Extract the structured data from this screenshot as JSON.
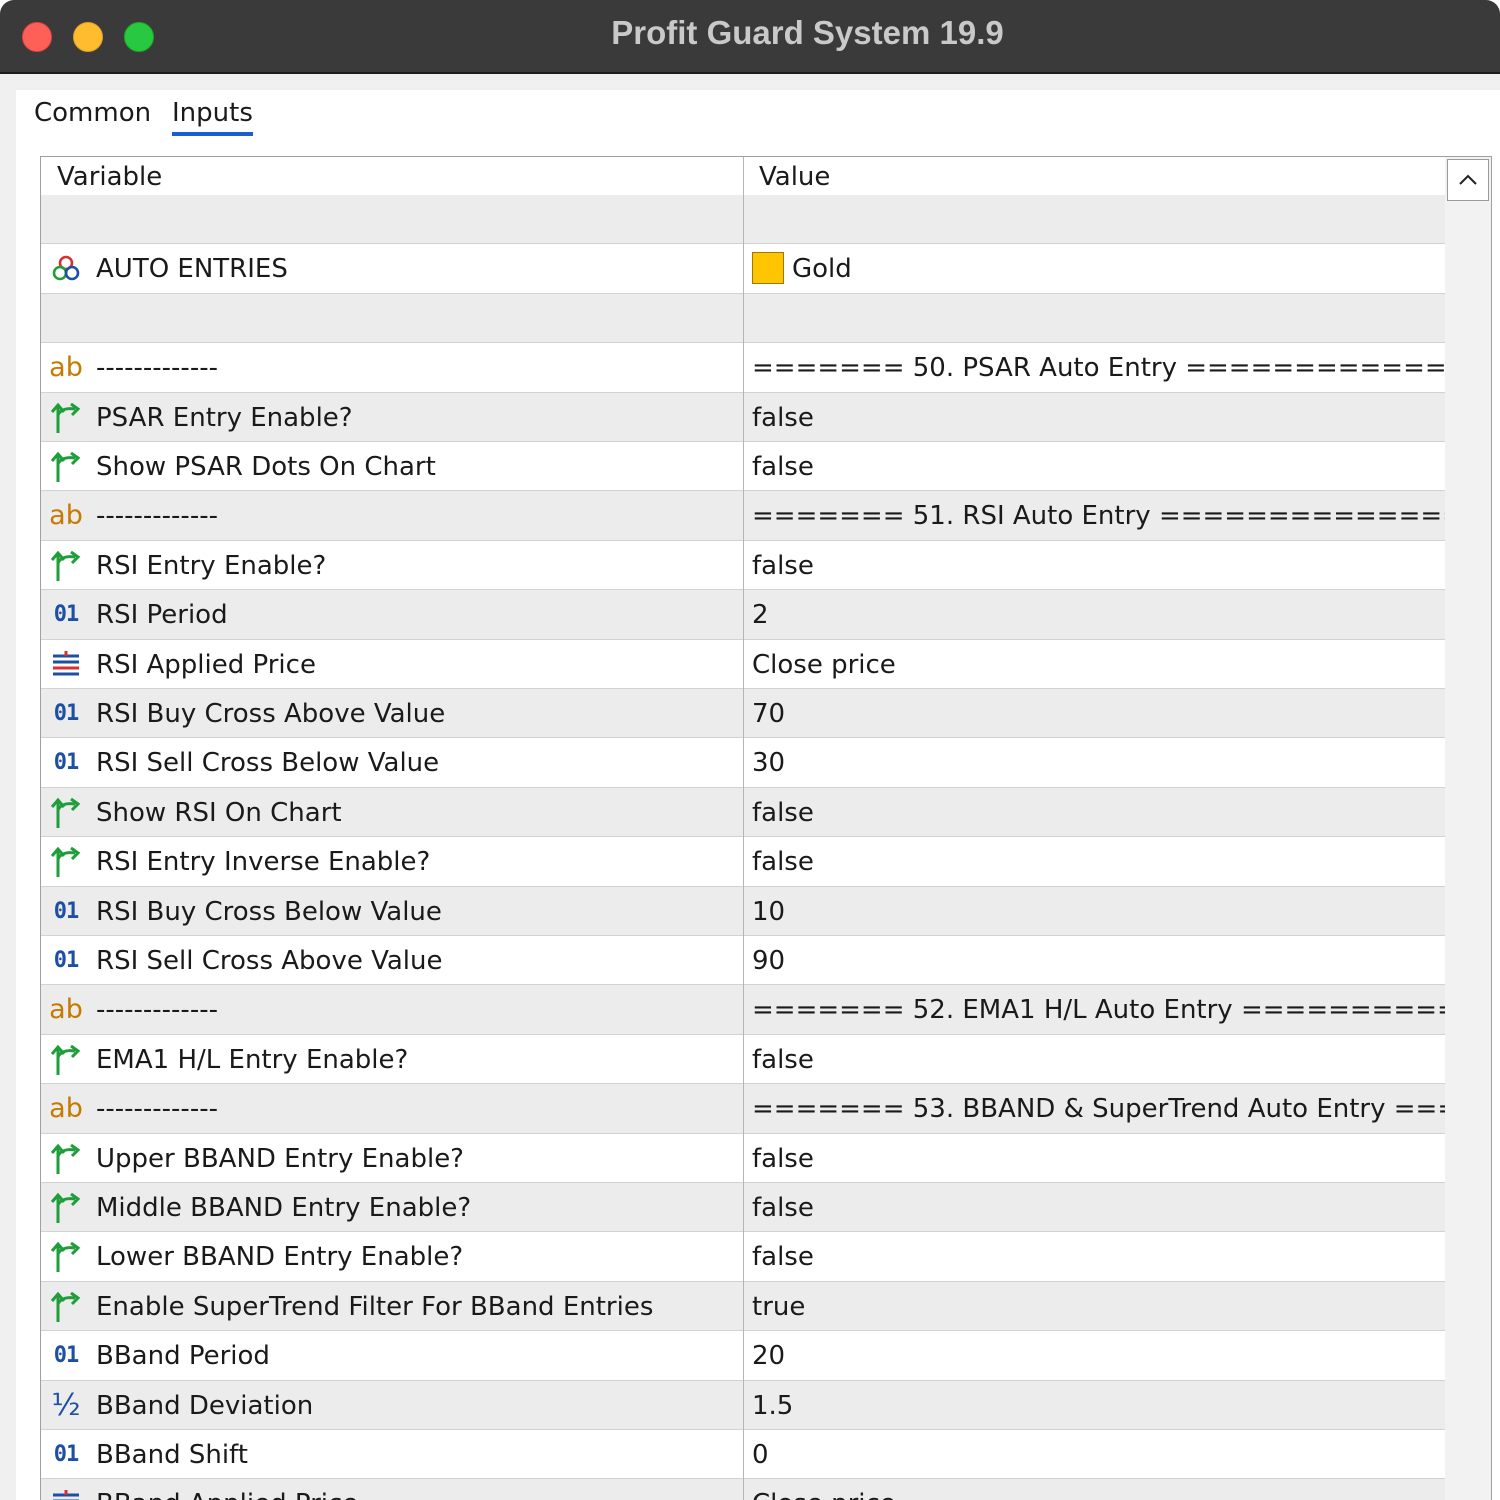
{
  "window": {
    "title": "Profit Guard System 19.9"
  },
  "tabs": [
    {
      "label": "Common"
    },
    {
      "label": "Inputs"
    }
  ],
  "table": {
    "headers": {
      "variable": "Variable",
      "value": "Value"
    },
    "rows": [
      {
        "icon": "",
        "variable": "",
        "value": ""
      },
      {
        "icon": "color-palette-icon",
        "variable": "AUTO ENTRIES",
        "value": "Gold",
        "swatch": "#ffc500"
      },
      {
        "icon": "",
        "variable": "",
        "value": ""
      },
      {
        "icon": "string-icon",
        "variable": "-------------",
        "value": "======= 50. PSAR Auto Entry =============..."
      },
      {
        "icon": "boolean-icon",
        "variable": "PSAR Entry Enable?",
        "value": "false"
      },
      {
        "icon": "boolean-icon",
        "variable": "Show PSAR Dots On Chart",
        "value": "false"
      },
      {
        "icon": "string-icon",
        "variable": "-------------",
        "value": "======= 51. RSI Auto Entry ==============..."
      },
      {
        "icon": "boolean-icon",
        "variable": "RSI Entry Enable?",
        "value": "false"
      },
      {
        "icon": "integer-icon",
        "variable": "RSI Period",
        "value": "2"
      },
      {
        "icon": "enum-icon",
        "variable": "RSI Applied Price",
        "value": "Close price"
      },
      {
        "icon": "integer-icon",
        "variable": "RSI Buy Cross Above Value",
        "value": "70"
      },
      {
        "icon": "integer-icon",
        "variable": "RSI Sell Cross Below Value",
        "value": "30"
      },
      {
        "icon": "boolean-icon",
        "variable": "Show RSI On Chart",
        "value": "false"
      },
      {
        "icon": "boolean-icon",
        "variable": "RSI Entry Inverse Enable?",
        "value": "false"
      },
      {
        "icon": "integer-icon",
        "variable": "RSI Buy Cross Below Value",
        "value": "10"
      },
      {
        "icon": "integer-icon",
        "variable": "RSI Sell Cross Above Value",
        "value": "90"
      },
      {
        "icon": "string-icon",
        "variable": "-------------",
        "value": "======= 52. EMA1 H/L Auto Entry ==========..."
      },
      {
        "icon": "boolean-icon",
        "variable": "EMA1 H/L Entry Enable?",
        "value": "false"
      },
      {
        "icon": "string-icon",
        "variable": "-------------",
        "value": "======= 53. BBAND & SuperTrend Auto Entry ===..."
      },
      {
        "icon": "boolean-icon",
        "variable": "Upper BBAND Entry Enable?",
        "value": "false"
      },
      {
        "icon": "boolean-icon",
        "variable": "Middle BBAND Entry Enable?",
        "value": "false"
      },
      {
        "icon": "boolean-icon",
        "variable": "Lower BBAND Entry Enable?",
        "value": "false"
      },
      {
        "icon": "boolean-icon",
        "variable": "Enable SuperTrend Filter For BBand Entries",
        "value": "true"
      },
      {
        "icon": "integer-icon",
        "variable": "BBand Period",
        "value": "20"
      },
      {
        "icon": "double-icon",
        "variable": "BBand Deviation",
        "value": "1.5"
      },
      {
        "icon": "integer-icon",
        "variable": "BBand Shift",
        "value": "0"
      },
      {
        "icon": "enum-icon",
        "variable": "BBand Applied Price",
        "value": "Close price"
      }
    ]
  },
  "icon_glyphs": {
    "string": "ab",
    "integer": "01",
    "double": "½"
  },
  "colors": {
    "boolean_icon": "#1e9e3a",
    "string_icon": "#c77a00",
    "integer_icon": "#1d4fa3",
    "tab_underline": "#1a5fd0"
  }
}
